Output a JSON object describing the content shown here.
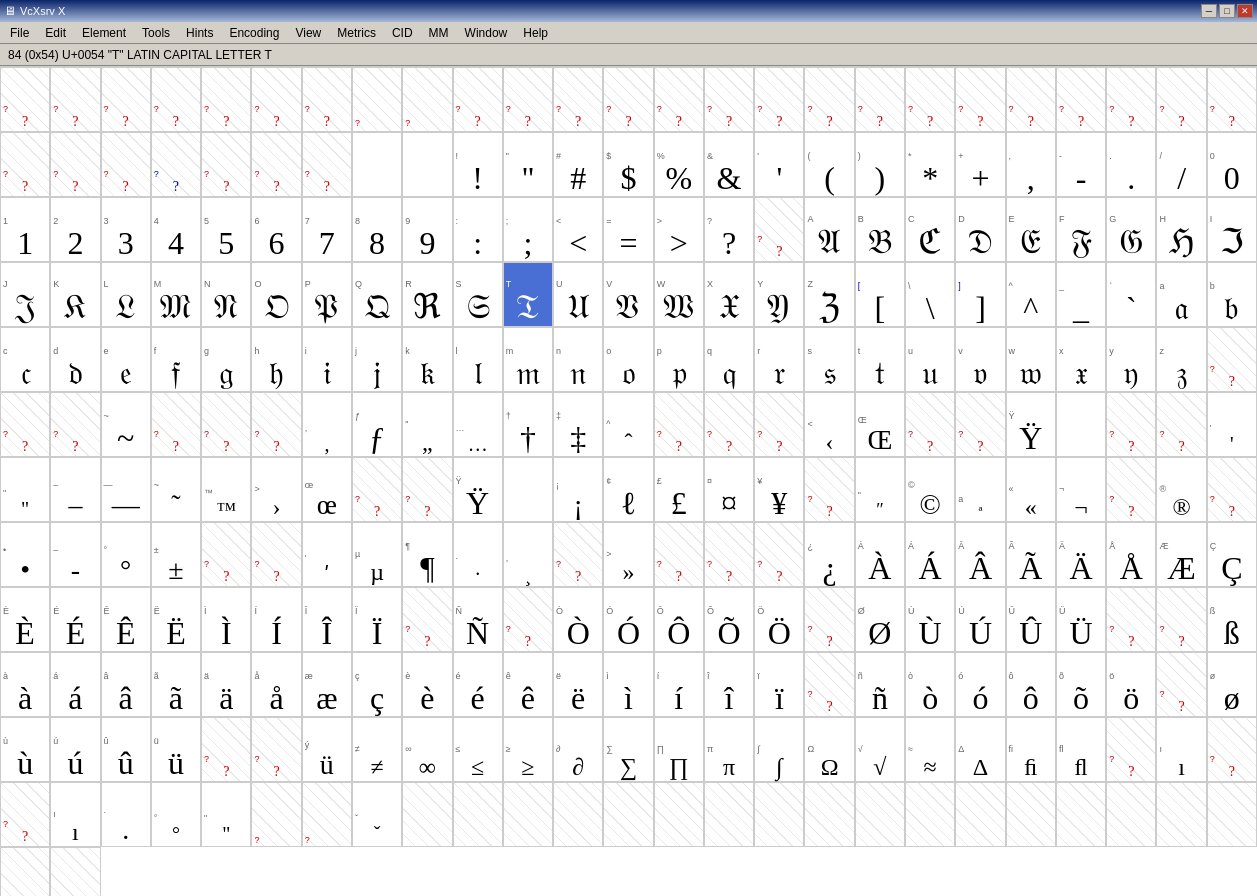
{
  "window": {
    "title": "VcXsrv X"
  },
  "titlebar": {
    "minimize": "─",
    "maximize": "□",
    "close": "✕"
  },
  "menubar": {
    "items": [
      "File",
      "Edit",
      "Element",
      "Tools",
      "Hints",
      "Encoding",
      "View",
      "Metrics",
      "CID",
      "MM",
      "Window",
      "Help"
    ]
  },
  "status": {
    "text": "84 (0x54) U+0054 \"T\" LATIN CAPITAL LETTER T"
  },
  "grid": {
    "cells": [
      {
        "label": "?",
        "char": "?",
        "type": "red",
        "empty": true
      },
      {
        "label": "?",
        "char": "?",
        "type": "red",
        "empty": true
      },
      {
        "label": "?",
        "char": "?",
        "type": "red",
        "empty": true
      },
      {
        "label": "?",
        "char": "?",
        "type": "red",
        "empty": true
      },
      {
        "label": "?",
        "char": "?",
        "type": "red",
        "empty": true
      },
      {
        "label": "?",
        "char": "?",
        "type": "red",
        "empty": true
      },
      {
        "label": "?",
        "char": "?",
        "type": "red",
        "empty": true
      },
      {
        "label": "?",
        "char": "?",
        "type": "red",
        "empty": true
      },
      {
        "label": "?",
        "char": "?",
        "type": "red",
        "empty": true
      },
      {
        "label": "?",
        "char": "?",
        "type": "red",
        "empty": true
      },
      {
        "label": "?",
        "char": "?",
        "type": "red",
        "empty": true
      },
      {
        "label": "?",
        "char": "?",
        "type": "red",
        "empty": true
      },
      {
        "label": "?",
        "char": "?",
        "type": "red",
        "empty": true
      },
      {
        "label": "?",
        "char": "?",
        "type": "red",
        "empty": true
      },
      {
        "label": "?",
        "char": "?",
        "type": "red",
        "empty": true
      },
      {
        "label": "?",
        "char": "?",
        "type": "red",
        "empty": true
      },
      {
        "label": "?",
        "char": "?",
        "type": "red",
        "empty": true
      },
      {
        "label": "?",
        "char": "?",
        "type": "red",
        "empty": true
      },
      {
        "label": "?",
        "char": "?",
        "type": "red",
        "empty": true
      },
      {
        "label": "?",
        "char": "?",
        "type": "red",
        "empty": true
      },
      {
        "label": "?",
        "char": "?",
        "type": "red",
        "empty": true
      },
      {
        "label": "?",
        "char": "?",
        "type": "red",
        "empty": true
      },
      {
        "label": "?",
        "char": "?",
        "type": "red",
        "empty": true
      },
      {
        "label": "?",
        "char": "?",
        "type": "red",
        "empty": true
      },
      {
        "label": "?",
        "char": "?",
        "type": "red",
        "empty": true
      }
    ]
  }
}
